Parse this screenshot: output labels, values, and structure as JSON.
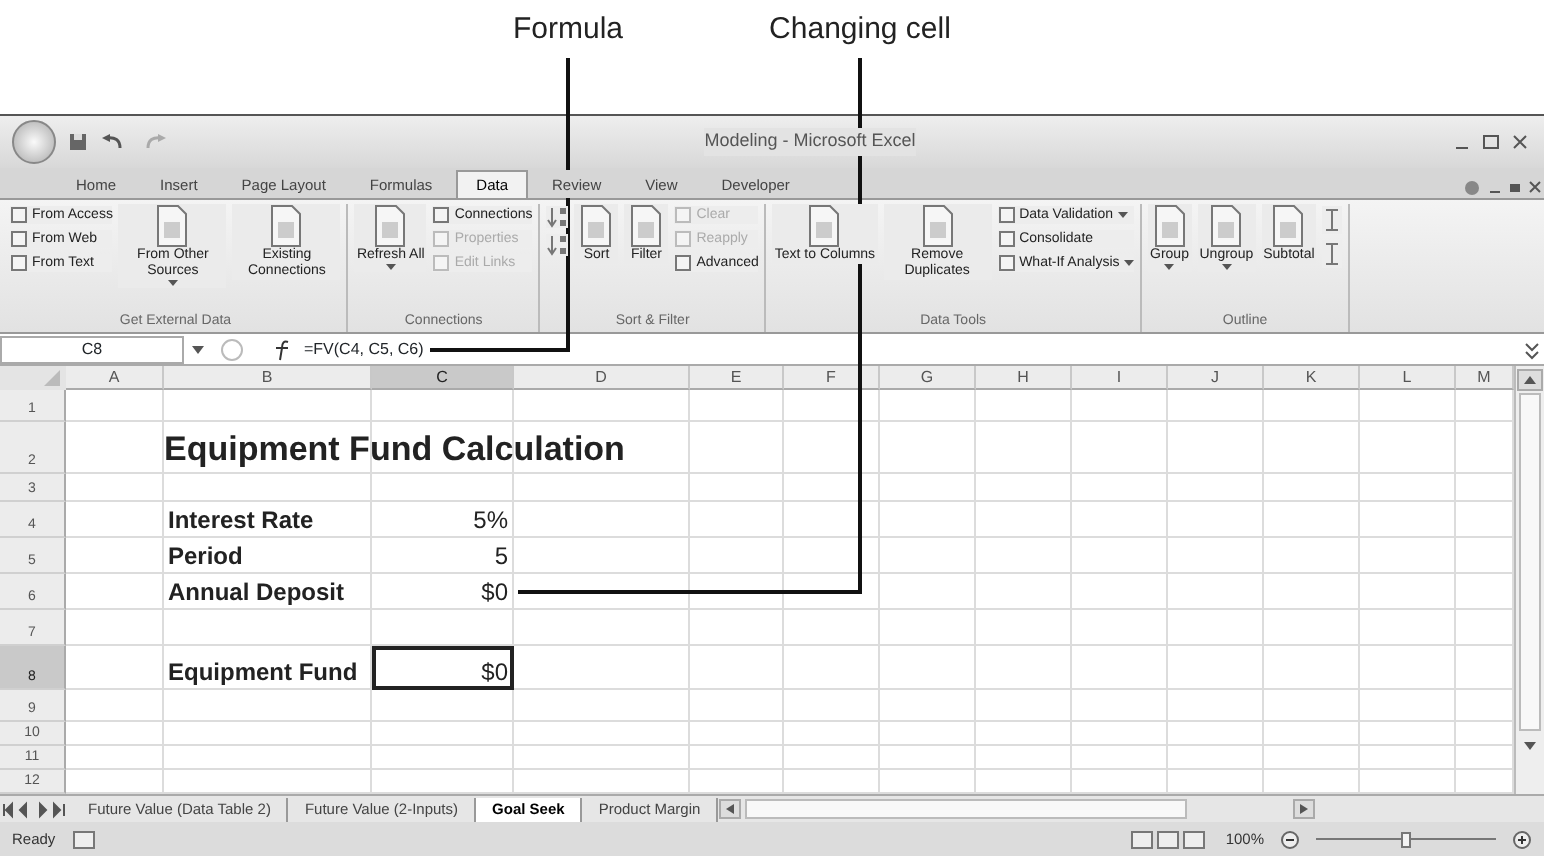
{
  "callouts": [
    {
      "text": "Formula"
    },
    {
      "text": "Changing cell"
    }
  ],
  "window": {
    "title": "Modeling - Microsoft Excel"
  },
  "ribbon_tabs": [
    {
      "label": "Home",
      "selected": false
    },
    {
      "label": "Insert",
      "selected": false
    },
    {
      "label": "Page Layout",
      "selected": false
    },
    {
      "label": "Formulas",
      "selected": false
    },
    {
      "label": "Data",
      "selected": true
    },
    {
      "label": "Review",
      "selected": false
    },
    {
      "label": "View",
      "selected": false
    },
    {
      "label": "Developer",
      "selected": false
    }
  ],
  "ribbon_groups": [
    {
      "label": "Get External Data",
      "items": [
        {
          "kind": "small",
          "label": "From Access",
          "disabled": false,
          "menu": false
        },
        {
          "kind": "small",
          "label": "From Web",
          "disabled": false,
          "menu": false
        },
        {
          "kind": "small",
          "label": "From Text",
          "disabled": false,
          "menu": false
        },
        {
          "kind": "large",
          "label": "From Other Sources",
          "disabled": false,
          "menu": true
        },
        {
          "kind": "large",
          "label": "Existing Connections",
          "disabled": false,
          "menu": false
        }
      ]
    },
    {
      "label": "Connections",
      "items": [
        {
          "kind": "large",
          "label": "Refresh All",
          "disabled": false,
          "menu": true
        },
        {
          "kind": "small",
          "label": "Connections",
          "disabled": false,
          "menu": false
        },
        {
          "kind": "small",
          "label": "Properties",
          "disabled": true,
          "menu": false
        },
        {
          "kind": "small",
          "label": "Edit Links",
          "disabled": true,
          "menu": false
        }
      ]
    },
    {
      "label": "Sort & Filter",
      "items": [
        {
          "kind": "sort",
          "disabled": false,
          "menu": false
        },
        {
          "kind": "sort",
          "disabled": false,
          "menu": false
        },
        {
          "kind": "large",
          "label": "Sort",
          "disabled": false,
          "menu": false
        },
        {
          "kind": "large",
          "label": "Filter",
          "disabled": false,
          "menu": false
        },
        {
          "kind": "small",
          "label": "Clear",
          "disabled": true,
          "menu": false
        },
        {
          "kind": "small",
          "label": "Reapply",
          "disabled": true,
          "menu": false
        },
        {
          "kind": "small",
          "label": "Advanced",
          "disabled": false,
          "menu": false
        }
      ]
    },
    {
      "label": "Data Tools",
      "items": [
        {
          "kind": "large",
          "label": "Text to Columns",
          "disabled": false,
          "menu": false
        },
        {
          "kind": "large",
          "label": "Remove Duplicates",
          "disabled": false,
          "menu": false
        },
        {
          "kind": "small",
          "label": "Data Validation",
          "disabled": false,
          "menu": true
        },
        {
          "kind": "small",
          "label": "Consolidate",
          "disabled": false,
          "menu": false
        },
        {
          "kind": "small",
          "label": "What-If Analysis",
          "disabled": false,
          "menu": true
        }
      ]
    },
    {
      "label": "Outline",
      "items": [
        {
          "kind": "large",
          "label": "Group",
          "disabled": false,
          "menu": true
        },
        {
          "kind": "large",
          "label": "Ungroup",
          "disabled": false,
          "menu": true
        },
        {
          "kind": "large",
          "label": "Subtotal",
          "disabled": false,
          "menu": false
        },
        {
          "kind": "icon",
          "disabled": false,
          "menu": false
        },
        {
          "kind": "icon",
          "disabled": false,
          "menu": false
        }
      ]
    }
  ],
  "formula_bar": {
    "name_box": "C8",
    "formula": "=FV(C4, C5, C6)"
  },
  "columns": [
    {
      "label": "A",
      "selected": false
    },
    {
      "label": "B",
      "selected": false
    },
    {
      "label": "C",
      "selected": true
    },
    {
      "label": "D",
      "selected": false
    },
    {
      "label": "E",
      "selected": false
    },
    {
      "label": "F",
      "selected": false
    },
    {
      "label": "G",
      "selected": false
    },
    {
      "label": "H",
      "selected": false
    },
    {
      "label": "I",
      "selected": false
    },
    {
      "label": "J",
      "selected": false
    },
    {
      "label": "K",
      "selected": false
    },
    {
      "label": "L",
      "selected": false
    },
    {
      "label": "M",
      "selected": false
    }
  ],
  "rows": [
    {
      "header": "1",
      "kind": "blank",
      "selected": false
    },
    {
      "header": "2",
      "kind": "title",
      "label": "Equipment Fund Calculation",
      "selected": false
    },
    {
      "header": "3",
      "kind": "blank",
      "selected": false
    },
    {
      "header": "4",
      "kind": "entry",
      "label": "Interest Rate",
      "value": "5%",
      "selected": false
    },
    {
      "header": "5",
      "kind": "entry",
      "label": "Period",
      "value": "5",
      "selected": false
    },
    {
      "header": "6",
      "kind": "entry",
      "label": "Annual Deposit",
      "value": "$0",
      "selected": false
    },
    {
      "header": "7",
      "kind": "blank",
      "selected": false
    },
    {
      "header": "8",
      "kind": "entry",
      "label": "Equipment Fund",
      "value": "$0",
      "selected": true
    },
    {
      "header": "9",
      "kind": "blank",
      "selected": false
    },
    {
      "header": "10",
      "kind": "blank",
      "selected": false
    },
    {
      "header": "11",
      "kind": "blank",
      "selected": false
    },
    {
      "header": "12",
      "kind": "blank",
      "selected": false
    }
  ],
  "sheet_tabs": [
    {
      "label": "Future Value (Data Table 2)",
      "selected": false
    },
    {
      "label": "Future Value (2-Inputs)",
      "selected": false
    },
    {
      "label": "Goal Seek",
      "selected": true
    },
    {
      "label": "Product Margin",
      "selected": false
    }
  ],
  "status_bar": {
    "status": "Ready",
    "zoom": "100%",
    "zoom_slider": {
      "level": 0.5
    }
  }
}
